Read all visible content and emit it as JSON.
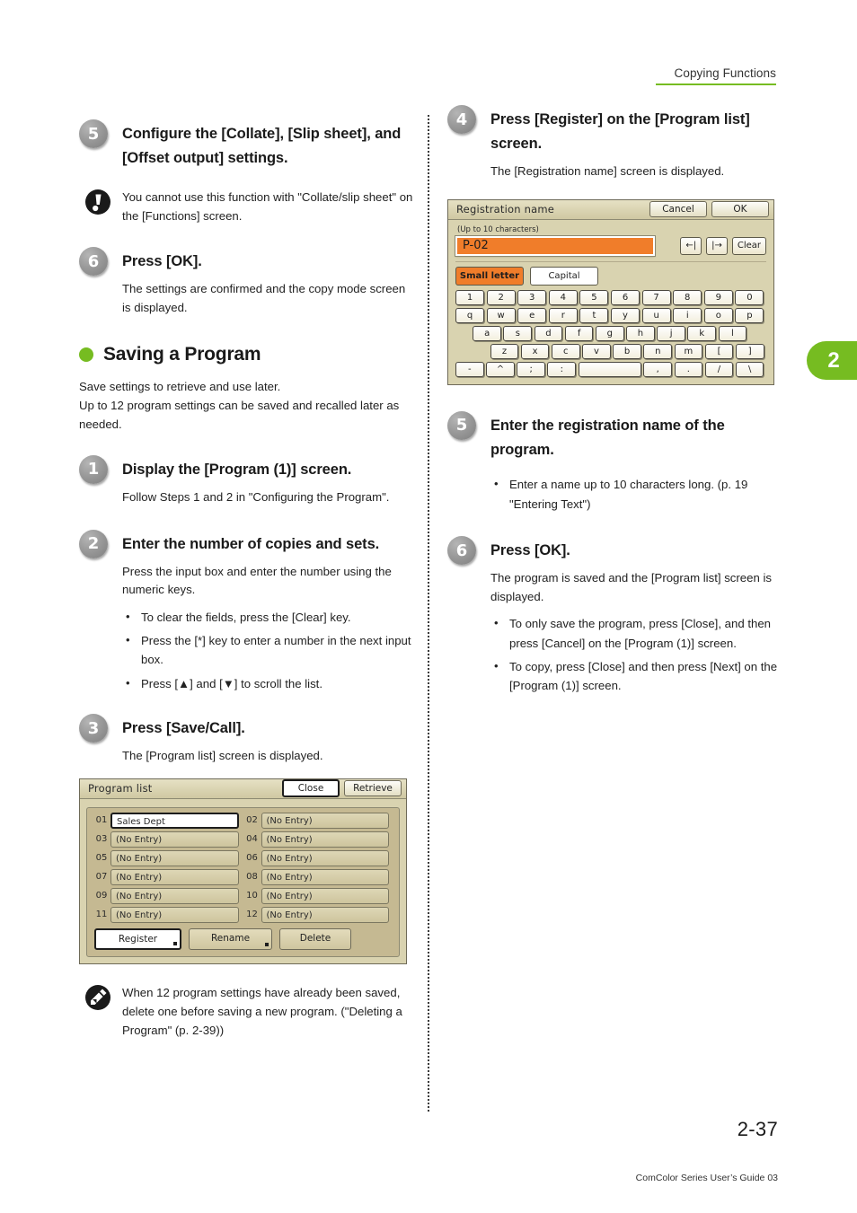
{
  "header": {
    "title": "Copying Functions"
  },
  "chapter_tab": {
    "number": "2"
  },
  "left_column": {
    "step5": {
      "badge": "5",
      "title": "Configure the [Collate], [Slip sheet], and [Offset output] settings."
    },
    "note_caution": {
      "icon": "caution-exclamation-icon",
      "text": "You cannot use this function with \"Collate/slip sheet\" on the [Functions] screen."
    },
    "step6": {
      "badge": "6",
      "title": "Press [OK].",
      "body": "The settings are confirmed and the copy mode screen is displayed."
    },
    "section": {
      "heading": "Saving a Program",
      "intro": "Save settings to retrieve and use later.\nUp to 12 program settings can be saved and recalled later as needed."
    },
    "step1": {
      "badge": "1",
      "title": "Display the [Program (1)] screen.",
      "body": "Follow Steps 1 and 2 in \"Configuring the Program\"."
    },
    "step2": {
      "badge": "2",
      "title": "Enter the number of copies and sets.",
      "body": "Press the input box and enter the number using the numeric keys.",
      "bullets": [
        "To clear the fields, press the [Clear] key.",
        "Press the [*] key to enter a number in the next input box.",
        "Press [▲] and [▼] to scroll the list."
      ]
    },
    "step3": {
      "badge": "3",
      "title": "Press [Save/Call].",
      "body": "The [Program list] screen is displayed."
    },
    "note_memo": {
      "icon": "memo-pencil-icon",
      "text": "When 12 program settings have already been saved, delete one before saving a new program. (\"Deleting a Program\" (p. 2-39))"
    }
  },
  "right_column": {
    "step4": {
      "badge": "4",
      "title": "Press [Register] on the [Program list] screen.",
      "body": "The [Registration name] screen is displayed."
    },
    "step5": {
      "badge": "5",
      "title": "Enter the registration name of the program.",
      "bullets": [
        "Enter a name up to 10 characters long. (p. 19 \"Entering Text\")"
      ]
    },
    "step6": {
      "badge": "6",
      "title": "Press [OK].",
      "body": "The program is saved and the [Program list] screen is displayed.",
      "bullets": [
        "To only save the program, press [Close], and then press [Cancel] on the [Program (1)] screen.",
        "To copy, press [Close] and then press [Next] on the [Program (1)] screen."
      ]
    }
  },
  "program_list_screen": {
    "title": "Program list",
    "close_label": "Close",
    "retrieve_label": "Retrieve",
    "entries": [
      {
        "num": "01",
        "value": "Sales Dept",
        "filled": true
      },
      {
        "num": "02",
        "value": "(No Entry)",
        "filled": false
      },
      {
        "num": "03",
        "value": "(No Entry)",
        "filled": false
      },
      {
        "num": "04",
        "value": "(No Entry)",
        "filled": false
      },
      {
        "num": "05",
        "value": "(No Entry)",
        "filled": false
      },
      {
        "num": "06",
        "value": "(No Entry)",
        "filled": false
      },
      {
        "num": "07",
        "value": "(No Entry)",
        "filled": false
      },
      {
        "num": "08",
        "value": "(No Entry)",
        "filled": false
      },
      {
        "num": "09",
        "value": "(No Entry)",
        "filled": false
      },
      {
        "num": "10",
        "value": "(No Entry)",
        "filled": false
      },
      {
        "num": "11",
        "value": "(No Entry)",
        "filled": false
      },
      {
        "num": "12",
        "value": "(No Entry)",
        "filled": false
      }
    ],
    "register_label": "Register",
    "rename_label": "Rename",
    "delete_label": "Delete"
  },
  "registration_name_screen": {
    "title": "Registration name",
    "cancel_label": "Cancel",
    "ok_label": "OK",
    "hint": "(Up to 10 characters)",
    "input_value": "P-02",
    "cursor_left_label": "←|",
    "cursor_right_label": "|→",
    "clear_label": "Clear",
    "small_letter_label": "Small letter",
    "capital_label": "Capital",
    "keyboard_rows": [
      [
        "1",
        "2",
        "3",
        "4",
        "5",
        "6",
        "7",
        "8",
        "9",
        "0"
      ],
      [
        "q",
        "w",
        "e",
        "r",
        "t",
        "y",
        "u",
        "i",
        "o",
        "p"
      ],
      [
        "a",
        "s",
        "d",
        "f",
        "g",
        "h",
        "j",
        "k",
        "l"
      ],
      [
        "z",
        "x",
        "c",
        "v",
        "b",
        "n",
        "m",
        "[",
        "]"
      ],
      [
        "-",
        "^",
        ";",
        ":",
        " ",
        ",",
        ".",
        "/",
        "\\"
      ]
    ],
    "accent_color": "#f07d2a"
  },
  "footer": {
    "page_number": "2-37",
    "credit": "ComColor Series User’s Guide 03"
  }
}
